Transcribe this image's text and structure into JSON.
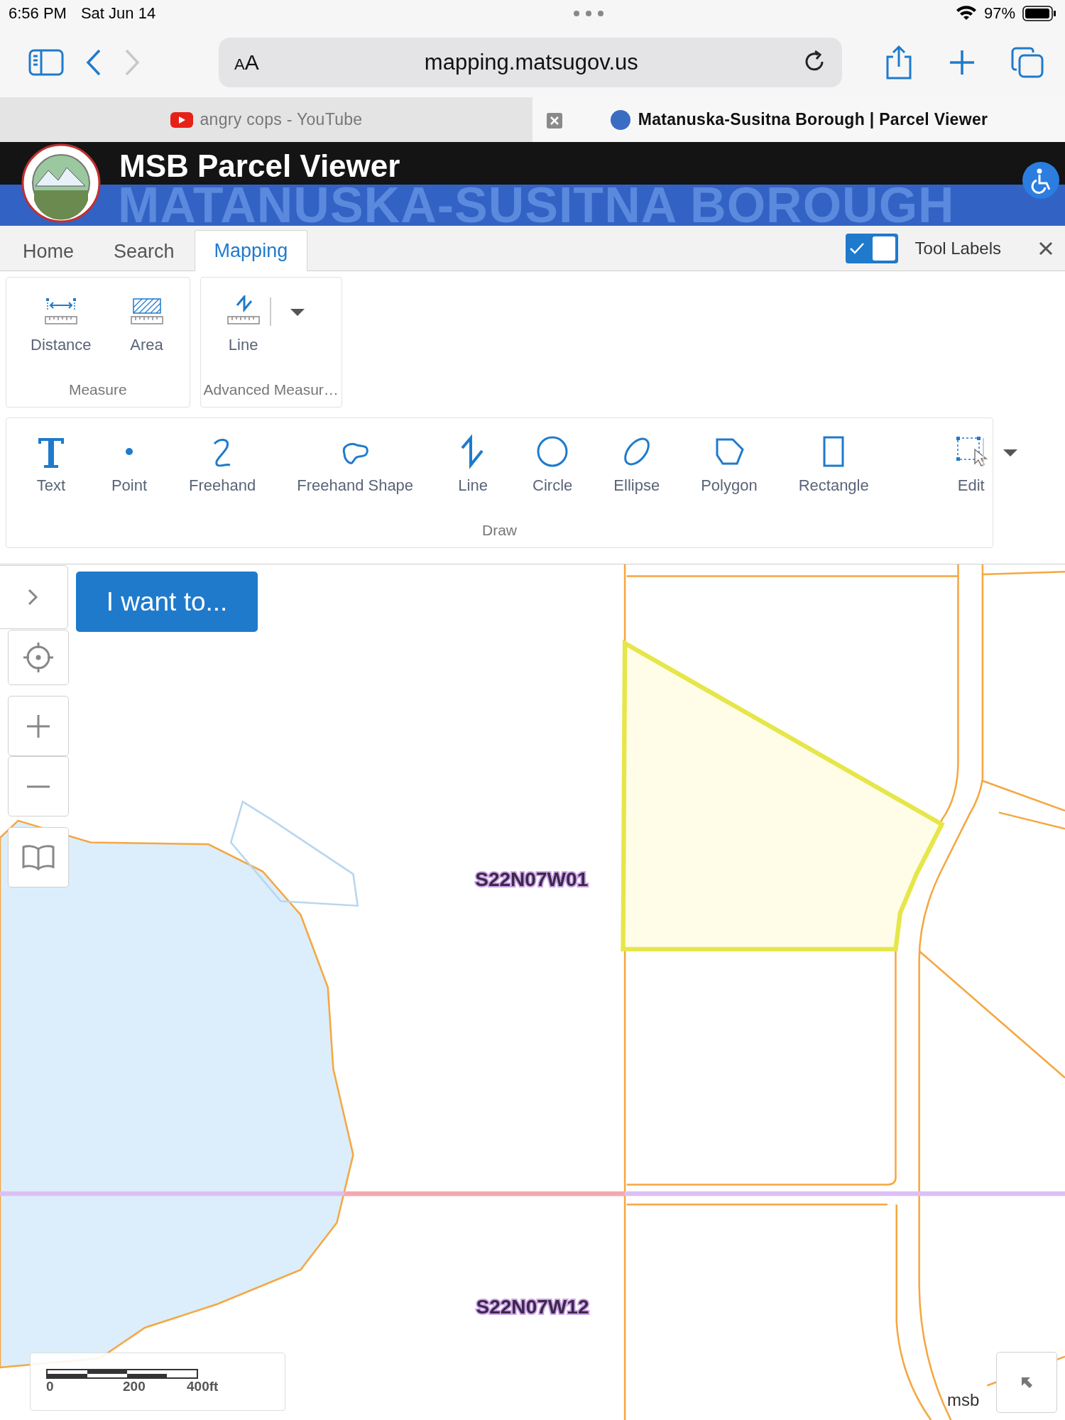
{
  "status_bar": {
    "time": "6:56 PM",
    "date": "Sat Jun 14",
    "battery": "97%"
  },
  "browser": {
    "text_size_button": "AA",
    "address": "mapping.matsugov.us",
    "tabs": [
      {
        "title": "angry cops - YouTube",
        "selected": false,
        "kind": "video"
      },
      {
        "title": "Matanuska-Susitna Borough | Parcel Viewer",
        "selected": true,
        "kind": "site"
      }
    ]
  },
  "header": {
    "title": "MSB Parcel Viewer",
    "banner": "MATANUSKA-SUSITNA BOROUGH"
  },
  "nav": {
    "tabs": [
      {
        "label": "Home",
        "selected": false
      },
      {
        "label": "Search",
        "selected": false
      },
      {
        "label": "Mapping",
        "selected": true
      }
    ],
    "tool_labels": {
      "label": "Tool Labels",
      "checked": true
    }
  },
  "ribbon": {
    "rows": [
      [
        {
          "label": "Measure",
          "dropdown": false,
          "tools": [
            {
              "label": "Distance",
              "kind": "distance"
            },
            {
              "label": "Area",
              "kind": "area"
            }
          ]
        },
        {
          "label": "Advanced Measur…",
          "dropdown": true,
          "tools": [
            {
              "label": "Line",
              "kind": "measure_line"
            }
          ]
        }
      ],
      [
        {
          "label": "Draw",
          "dropdown": true,
          "tools": [
            {
              "label": "Text",
              "kind": "text"
            },
            {
              "label": "Point",
              "kind": "point"
            },
            {
              "label": "Freehand",
              "kind": "freehand"
            },
            {
              "label": "Freehand Shape",
              "kind": "freehand_shape"
            },
            {
              "label": "Line",
              "kind": "line"
            },
            {
              "label": "Circle",
              "kind": "circle"
            },
            {
              "label": "Ellipse",
              "kind": "ellipse"
            },
            {
              "label": "Polygon",
              "kind": "polygon"
            },
            {
              "label": "Rectangle",
              "kind": "rectangle"
            },
            {
              "label": "Edit",
              "kind": "edit"
            }
          ]
        }
      ]
    ]
  },
  "map": {
    "action_button": "I want to...",
    "parcel_labels": [
      "S22N07W01",
      "S22N07W12"
    ],
    "scale_labels": [
      "0",
      "200",
      "400ft"
    ],
    "attribution": "msb"
  }
}
